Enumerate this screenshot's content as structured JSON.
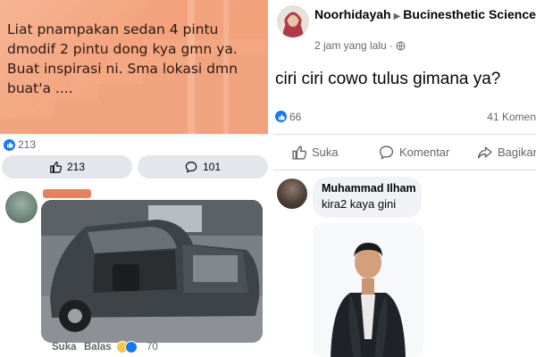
{
  "left_post": {
    "text": "Liat pnampakan sedan 4 pintu dmodif 2 pintu dong kya gmn ya. Buat inspirasi ni. Sma lokasi dmn buat'a ....",
    "reaction_count": "213",
    "like_button_count": "213",
    "comment_button_count": "101",
    "comment": {
      "actions": {
        "like": "Suka",
        "reply": "Balas"
      },
      "reaction_count": "70"
    }
  },
  "right_post": {
    "author": "Noorhidayah",
    "group": "Bucinesthetic Science",
    "time": "2 jam yang lalu",
    "question": "ciri ciri cowo tulus gimana ya?",
    "reaction_count": "66",
    "comment_count": "41 Komen",
    "actions": {
      "like": "Suka",
      "comment": "Komentar",
      "share": "Bagikan"
    },
    "comment": {
      "author": "Muhammad Ilham",
      "text": "kira2 kaya gini"
    }
  },
  "colors": {
    "facebook_blue": "#1877f2",
    "post_background": "#f3a27c",
    "meta_gray": "#65676b"
  },
  "icons": [
    "like-thumb-icon",
    "comment-icon",
    "share-icon",
    "globe-icon",
    "group-arrow-icon",
    "haha-emoji-icon",
    "like-reaction-icon"
  ]
}
